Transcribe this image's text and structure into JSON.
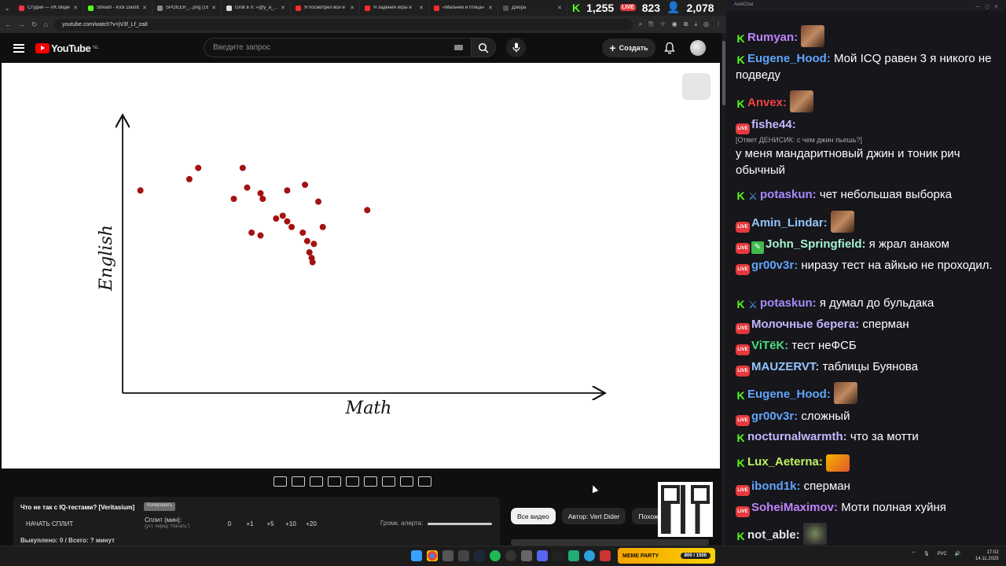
{
  "browser": {
    "tabs": [
      {
        "label": "Студия — VK Видео",
        "color": "#ff3347"
      },
      {
        "label": "Stream - Kick Dashb",
        "color": "#53fc18"
      },
      {
        "label": "SPOILER_...png (16:",
        "color": "#888888"
      },
      {
        "label": "Grok в X: «@y_a_...",
        "color": "#dddddd"
      },
      {
        "label": "Я посмотрел все и",
        "color": "#ff2b2b"
      },
      {
        "label": "Я задения игры и",
        "color": "#ff2b2b"
      },
      {
        "label": "«Мальчик и птица»",
        "color": "#ff2b2b"
      },
      {
        "label": "Дзюра",
        "color": "#555555"
      }
    ],
    "url": "youtube.com/watch?v=jV3f_Lf_za8"
  },
  "stream_counters": {
    "kick": "1,255",
    "live": "823",
    "people": "2,078"
  },
  "youtube": {
    "logo_text": "YouTube",
    "region": "NL",
    "search_placeholder": "Введите запрос",
    "create_label": "Создать"
  },
  "chart_data": {
    "type": "scatter",
    "xlabel": "Math",
    "ylabel": "English",
    "xlim": [
      0,
      100
    ],
    "ylim": [
      0,
      100
    ],
    "grid": false,
    "points": [
      {
        "x": 4,
        "y": 72
      },
      {
        "x": 17,
        "y": 80
      },
      {
        "x": 15,
        "y": 76
      },
      {
        "x": 27,
        "y": 80
      },
      {
        "x": 25,
        "y": 69
      },
      {
        "x": 28,
        "y": 73
      },
      {
        "x": 31,
        "y": 71
      },
      {
        "x": 31.5,
        "y": 69
      },
      {
        "x": 37,
        "y": 72
      },
      {
        "x": 41,
        "y": 74
      },
      {
        "x": 44,
        "y": 68
      },
      {
        "x": 55,
        "y": 65
      },
      {
        "x": 29,
        "y": 57
      },
      {
        "x": 31,
        "y": 56
      },
      {
        "x": 34.5,
        "y": 62
      },
      {
        "x": 36,
        "y": 63
      },
      {
        "x": 37,
        "y": 61
      },
      {
        "x": 38,
        "y": 59
      },
      {
        "x": 40.5,
        "y": 57
      },
      {
        "x": 41.5,
        "y": 54
      },
      {
        "x": 43,
        "y": 53
      },
      {
        "x": 42,
        "y": 50
      },
      {
        "x": 42.5,
        "y": 48
      },
      {
        "x": 42.7,
        "y": 46.5
      },
      {
        "x": 45,
        "y": 59
      }
    ]
  },
  "player_tools": [
    "loop-icon",
    "cast-icon",
    "pip-icon",
    "clip-icon",
    "screen-icon",
    "speed-icon",
    "add-icon",
    "camera-icon",
    "settings-icon"
  ],
  "split_panel": {
    "title": "Что не так с IQ-тестами? [Veritasium]",
    "copy_label": "Копировать",
    "start_label": "НАЧАТЬ СПЛИТ",
    "split_label": "Сплит (мин):",
    "split_hint": "(уст. перед \"Начать\")",
    "buttons": [
      "0",
      "+1",
      "+5",
      "+10",
      "+20"
    ],
    "alert_label": "Громк. алерта:",
    "status": "Выкуплено: 0 / Всего: ? минут"
  },
  "chips": [
    "Все видео",
    "Автор: Vert Dider",
    "Похожие"
  ],
  "chat": {
    "title": "AxelChat",
    "messages": [
      {
        "platform": "kick",
        "badge2": "",
        "nick": "Rumyan:",
        "color": "#c084fc",
        "text": "",
        "emote": "face",
        "reply": ""
      },
      {
        "platform": "kick",
        "badge2": "",
        "nick": "Eugene_Hood:",
        "color": "#60a5fa",
        "text": "Мой ICQ равен 3 я никого не подведу",
        "emote": "",
        "reply": ""
      },
      {
        "platform": "kick",
        "badge2": "",
        "nick": "Anvex:",
        "color": "#ef4444",
        "text": "",
        "emote": "face",
        "reply": ""
      },
      {
        "platform": "live",
        "badge2": "",
        "nick": "fishe44:",
        "color": "#c4b5fd",
        "text": "у меня мандаритновый джин и тоник рич обычный",
        "emote": "",
        "reply": "[Ответ ДЕНИСИК: с чем джин пьешь?]"
      },
      {
        "platform": "kick",
        "badge2": "sword",
        "nick": "potaskun:",
        "color": "#a78bfa",
        "text": "чет небольшая выборка",
        "emote": "",
        "reply": ""
      },
      {
        "platform": "live",
        "badge2": "",
        "nick": "Amin_Lindar:",
        "color": "#93c5fd",
        "text": "",
        "emote": "face",
        "reply": ""
      },
      {
        "platform": "live",
        "badge2": "pencil",
        "nick": "John_Springfield:",
        "color": "#a7f3d0",
        "text": "я жрал анаком",
        "emote": "",
        "reply": ""
      },
      {
        "platform": "live",
        "badge2": "",
        "nick": "gr00v3r:",
        "color": "#60a5fa",
        "text": "ниразу тест на айкью не проходил.",
        "emote": "",
        "reply": ""
      },
      {
        "platform": "kick",
        "badge2": "sword",
        "nick": "potaskun:",
        "color": "#a78bfa",
        "text": "я думал до бульдака",
        "emote": "",
        "reply": ""
      },
      {
        "platform": "live",
        "badge2": "",
        "nick": "Молочные берега:",
        "color": "#c4b5fd",
        "text": "сперман",
        "emote": "",
        "reply": ""
      },
      {
        "platform": "live",
        "badge2": "",
        "nick": "ViTёK:",
        "color": "#4ade80",
        "text": "тест неФСБ",
        "emote": "",
        "reply": ""
      },
      {
        "platform": "live",
        "badge2": "",
        "nick": "MAUZERVT:",
        "color": "#93c5fd",
        "text": "таблицы Буянова",
        "emote": "",
        "reply": ""
      },
      {
        "platform": "kick",
        "badge2": "",
        "nick": "Eugene_Hood:",
        "color": "#60a5fa",
        "text": "",
        "emote": "face",
        "reply": ""
      },
      {
        "platform": "live",
        "badge2": "",
        "nick": "gr00v3r:",
        "color": "#60a5fa",
        "text": "сложный",
        "emote": "",
        "reply": ""
      },
      {
        "platform": "kick",
        "badge2": "",
        "nick": "nocturnalwarmth:",
        "color": "#c4b5fd",
        "text": "что за мотти",
        "emote": "",
        "reply": ""
      },
      {
        "platform": "kick",
        "badge2": "",
        "nick": "Lux_Aeterna:",
        "color": "#bef264",
        "text": "",
        "emote": "small",
        "reply": ""
      },
      {
        "platform": "live",
        "badge2": "",
        "nick": "ibond1k:",
        "color": "#60a5fa",
        "text": "сперман",
        "emote": "",
        "reply": ""
      },
      {
        "platform": "live",
        "badge2": "",
        "nick": "SoheiMaximov:",
        "color": "#c084fc",
        "text": "Моти полная хуйня",
        "emote": "",
        "reply": ""
      },
      {
        "platform": "kick",
        "badge2": "",
        "nick": "not_able:",
        "color": "#e5e7eb",
        "text": "",
        "emote": "frog",
        "reply": ""
      }
    ]
  },
  "taskbar": {
    "meme_label": "MEME PARTY",
    "meme_count": "800 / 1500",
    "lang": "РУС",
    "time": "17:02",
    "date": "14.11.2025"
  }
}
